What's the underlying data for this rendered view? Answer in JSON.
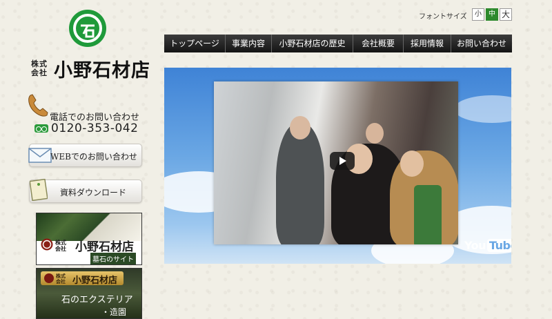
{
  "logo": {
    "kabu_line1": "株式",
    "kabu_line2": "会社",
    "name": "小野石材店"
  },
  "contact": {
    "phone_label": "電話でのお問い合わせ",
    "phone_number": "0120-353-042",
    "web_button": "WEBでのお問い合わせ",
    "download_button": "資料ダウンロード"
  },
  "font_size": {
    "label": "フォントサイズ",
    "small": "小",
    "medium": "中",
    "large": "大",
    "selected": "中"
  },
  "nav": {
    "items": [
      {
        "label": "トップページ"
      },
      {
        "label": "事業内容"
      },
      {
        "label": "小野石材店の歴史"
      },
      {
        "label": "会社概要"
      },
      {
        "label": "採用情報"
      },
      {
        "label": "お問い合わせ"
      }
    ]
  },
  "video": {
    "youtube_text_1": "You",
    "youtube_text_2": "Tube"
  },
  "banners": {
    "boseki": {
      "kabu_line1": "株式",
      "kabu_line2": "会社",
      "name": "小野石材店",
      "subtitle": "墓石のサイト"
    },
    "exterior": {
      "kabu_line1": "株式",
      "kabu_line2": "会社",
      "name": "小野石材店",
      "subtitle1": "石のエクステリア",
      "subtitle2": "・造園"
    }
  },
  "colors": {
    "brand_green": "#2a9a3a",
    "nav_bg": "#222222",
    "video_sky": "#4d8fdc"
  }
}
